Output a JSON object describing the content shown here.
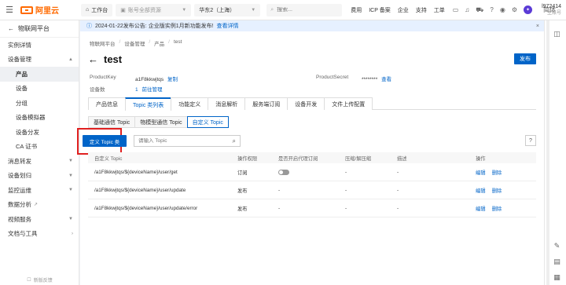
{
  "topbar": {
    "logo_text": "阿里云",
    "workspace": "工作台",
    "resource_group": "账号全部资源",
    "region": "华东2（上海）",
    "search_placeholder": "搜索...",
    "links": [
      "费用",
      "ICP 备案",
      "企业",
      "支持",
      "工单"
    ],
    "lang": "简体",
    "user_id": "l972414",
    "user_sub": "主账号"
  },
  "sidebar": {
    "back_label": "物联网平台",
    "items": [
      {
        "label": "实例详情",
        "level": 0
      },
      {
        "label": "设备管理",
        "level": 0,
        "expanded": true
      },
      {
        "label": "产品",
        "level": 1,
        "active": true
      },
      {
        "label": "设备",
        "level": 1
      },
      {
        "label": "分组",
        "level": 1
      },
      {
        "label": "设备模拟器",
        "level": 1
      },
      {
        "label": "设备分发",
        "level": 1
      },
      {
        "label": "CA 证书",
        "level": 1
      },
      {
        "label": "消息转发",
        "level": 0,
        "collapsed": true
      },
      {
        "label": "设备划归",
        "level": 0,
        "collapsed": true
      },
      {
        "label": "监控运维",
        "level": 0,
        "collapsed": true
      },
      {
        "label": "数据分析",
        "level": 0,
        "external": true
      },
      {
        "label": "视频服务",
        "level": 0,
        "collapsed": true
      },
      {
        "label": "文档与工具",
        "level": 0
      }
    ],
    "footer": "新版反馈"
  },
  "notice": {
    "text": "2024-01-22发布公告: 企业版实例1月新功能发布!",
    "link": "查看详情"
  },
  "breadcrumb": [
    "物联网平台",
    "设备管理",
    "产品",
    "test"
  ],
  "page": {
    "title": "test",
    "publish_label": "发布",
    "product_key_label": "ProductKey",
    "product_key_value": "a1F8kkwjtqs",
    "copy_label": "复制",
    "product_secret_label": "ProductSecret",
    "product_secret_value": "********",
    "view_label": "查看",
    "device_count_label": "设备数",
    "device_count_value": "1",
    "manage_label": "前往管理"
  },
  "tabs": [
    "产品信息",
    "Topic 类列表",
    "功能定义",
    "消息解析",
    "服务端订阅",
    "设备开发",
    "文件上传配置"
  ],
  "active_tab": "Topic 类列表",
  "subtabs": [
    "基础通信 Topic",
    "物模型通信 Topic",
    "自定义 Topic"
  ],
  "active_subtab": "自定义 Topic",
  "toolbar": {
    "define_label": "定义 Topic 类",
    "search_placeholder": "请输入 Topic",
    "help_label": "?"
  },
  "table": {
    "headers": [
      "自定义 Topic",
      "操作权限",
      "是否开启代理订阅",
      "压缩/解压缩",
      "描述",
      "操作"
    ],
    "rows": [
      {
        "topic": "/a1F8kkwjtqs/${deviceName}/user/get",
        "perm": "订阅",
        "proxy": "toggle-off",
        "compress": "-",
        "desc": "-",
        "edit": "编辑",
        "del": "删除"
      },
      {
        "topic": "/a1F8kkwjtqs/${deviceName}/user/update",
        "perm": "发布",
        "proxy": "-",
        "compress": "-",
        "desc": "-",
        "edit": "编辑",
        "del": "删除"
      },
      {
        "topic": "/a1F8kkwjtqs/${deviceName}/user/update/error",
        "perm": "发布",
        "proxy": "-",
        "compress": "-",
        "desc": "-",
        "edit": "编辑",
        "del": "删除"
      }
    ]
  },
  "colors": {
    "accent": "#0064c8",
    "brand": "#ff6a00",
    "highlight": "#e02020"
  }
}
